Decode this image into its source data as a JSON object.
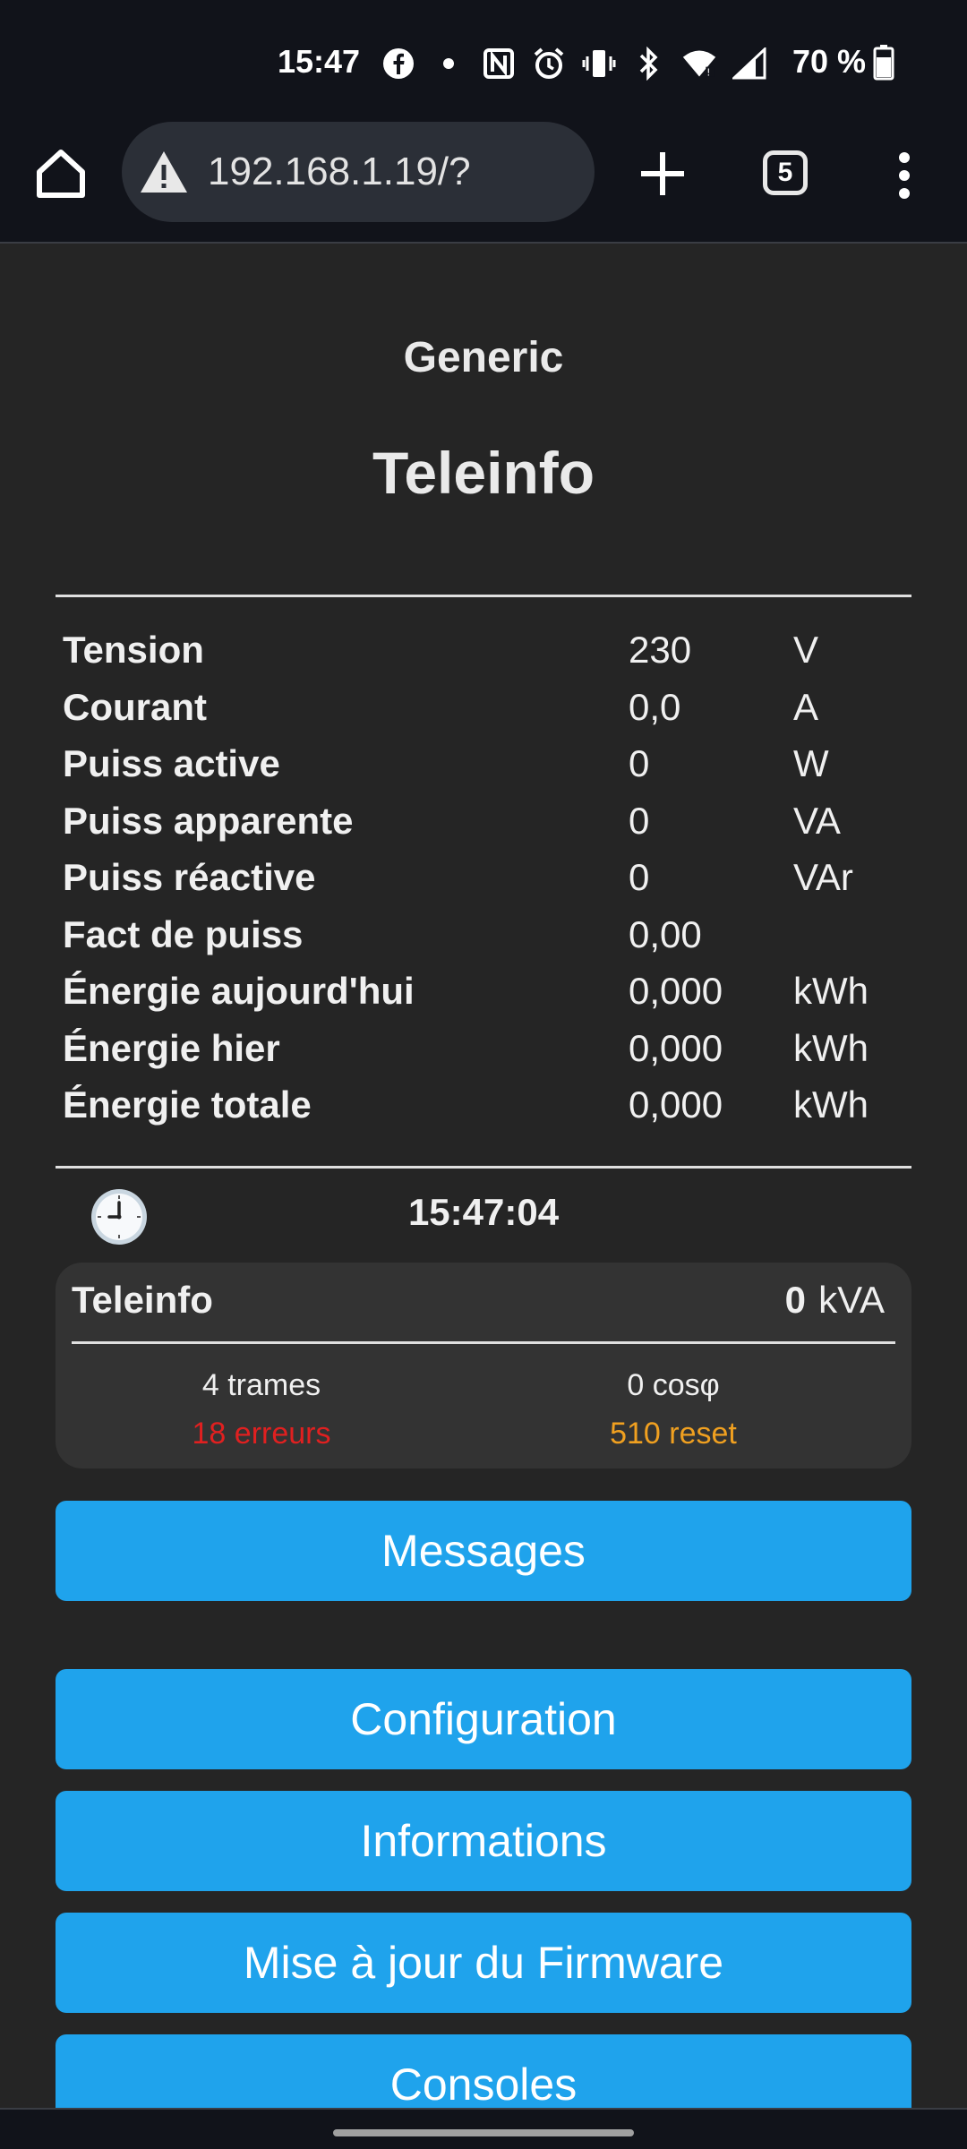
{
  "status_bar": {
    "time": "15:47",
    "icons": [
      "facebook-icon",
      "dot-icon",
      "nfc-icon",
      "alarm-icon",
      "vibrate-icon",
      "bluetooth-icon",
      "wifi-icon",
      "signal-icon"
    ],
    "battery_text": "70 %",
    "battery_level": 0.7
  },
  "browser": {
    "url": "192.168.1.19/?",
    "tab_count": "5"
  },
  "header": {
    "device_name": "Generic",
    "title": "Teleinfo"
  },
  "metrics": [
    {
      "label": "Tension",
      "value": "230",
      "unit": "V"
    },
    {
      "label": "Courant",
      "value": "0,0",
      "unit": "A"
    },
    {
      "label": "Puiss active",
      "value": "0",
      "unit": "W"
    },
    {
      "label": "Puiss apparente",
      "value": "0",
      "unit": "VA"
    },
    {
      "label": "Puiss réactive",
      "value": "0",
      "unit": "VAr"
    },
    {
      "label": "Fact de puiss",
      "value": "0,00",
      "unit": ""
    },
    {
      "label": "Énergie aujourd'hui",
      "value": "0,000",
      "unit": "kWh"
    },
    {
      "label": "Énergie hier",
      "value": "0,000",
      "unit": "kWh"
    },
    {
      "label": "Énergie totale",
      "value": "0,000",
      "unit": "kWh"
    }
  ],
  "clock": {
    "time": "15:47:04"
  },
  "card": {
    "title": "Teleinfo",
    "value": "0",
    "unit": "kVA",
    "frames": "4 trames",
    "cos": "0 cosφ",
    "errors": "18 erreurs",
    "reset": "510 reset",
    "error_color": "#e02020",
    "reset_color": "#f0a020"
  },
  "buttons": {
    "messages": "Messages",
    "configuration": "Configuration",
    "informations": "Informations",
    "firmware": "Mise à jour du Firmware",
    "consoles": "Consoles"
  },
  "colors": {
    "accent": "#1fa3ec",
    "background": "#252525"
  }
}
